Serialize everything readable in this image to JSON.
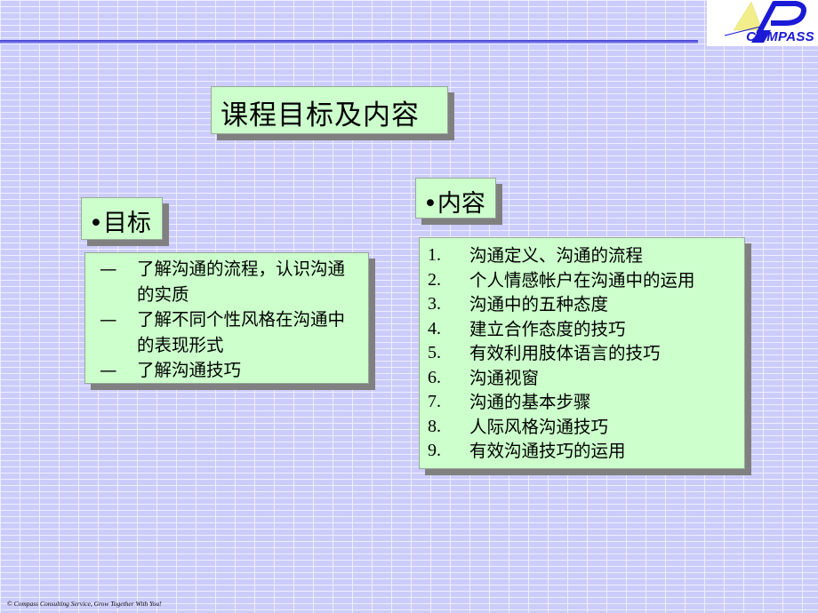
{
  "logo": {
    "text": "COMPASS",
    "colors": {
      "yellow": "#f2ef8a",
      "blue": "#1a1ad6"
    }
  },
  "title": "课程目标及内容",
  "goals": {
    "header": "•目标",
    "items": [
      {
        "marker": "—",
        "text": "了解沟通的流程，认识沟通的实质"
      },
      {
        "marker": "—",
        "text": "了解不同个性风格在沟通中的表现形式"
      },
      {
        "marker": "—",
        "text": "了解沟通技巧"
      }
    ]
  },
  "contents": {
    "header": "•内容",
    "items": [
      {
        "num": "1.",
        "text": "沟通定义、沟通的流程"
      },
      {
        "num": "2.",
        "text": "个人情感帐户在沟通中的运用"
      },
      {
        "num": "3.",
        "text": "沟通中的五种态度"
      },
      {
        "num": "4.",
        "text": "建立合作态度的技巧"
      },
      {
        "num": "5.",
        "text": "有效利用肢体语言的技巧"
      },
      {
        "num": "6.",
        "text": "沟通视窗"
      },
      {
        "num": "7.",
        "text": "沟通的基本步骤"
      },
      {
        "num": "8.",
        "text": "人际风格沟通技巧"
      },
      {
        "num": "9.",
        "text": "有效沟通技巧的运用"
      }
    ]
  },
  "footer": "© Compass Consulting Service, Grow Together With You!"
}
